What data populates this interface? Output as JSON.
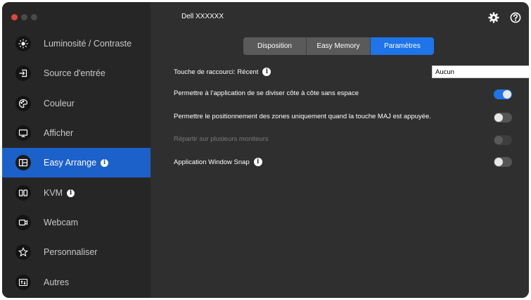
{
  "app": {
    "title": "Dell XXXXXX"
  },
  "colors": {
    "accent": "#1e74e8",
    "sidebar_active": "#1c61c9",
    "close": "#e0443e"
  },
  "sidebar": {
    "items": [
      {
        "label": "Luminosité / Contraste",
        "icon": "brightness-icon"
      },
      {
        "label": "Source d'entrée",
        "icon": "input-source-icon"
      },
      {
        "label": "Couleur",
        "icon": "color-palette-icon"
      },
      {
        "label": "Afficher",
        "icon": "monitor-icon"
      },
      {
        "label": "Easy Arrange",
        "icon": "easy-arrange-icon",
        "active": true,
        "info": true
      },
      {
        "label": "KVM",
        "icon": "kvm-icon",
        "info": true
      },
      {
        "label": "Webcam",
        "icon": "webcam-icon"
      },
      {
        "label": "Personnaliser",
        "icon": "star-icon"
      },
      {
        "label": "Autres",
        "icon": "others-icon"
      }
    ]
  },
  "header": {
    "settings_icon": "gear-icon",
    "help_icon": "help-icon"
  },
  "tabs": [
    {
      "label": "Disposition"
    },
    {
      "label": "Easy Memory"
    },
    {
      "label": "Paramètres",
      "active": true
    }
  ],
  "settings": {
    "hotkey": {
      "label": "Touche de raccourci: Récent",
      "value": "Aucun"
    },
    "split_side_by_side": {
      "label": "Permettre à l’application de se diviser côte à côte sans espace",
      "enabled": true
    },
    "shift_positioning": {
      "label": "Permettre le positionnement des zones uniquement quand la touche MAJ est appuyée.",
      "enabled": false
    },
    "multi_monitor": {
      "label": "Répartir sur plusieurs moniteurs",
      "enabled": false,
      "disabled": true
    },
    "window_snap": {
      "label": "Application Window Snap",
      "enabled": false
    }
  }
}
